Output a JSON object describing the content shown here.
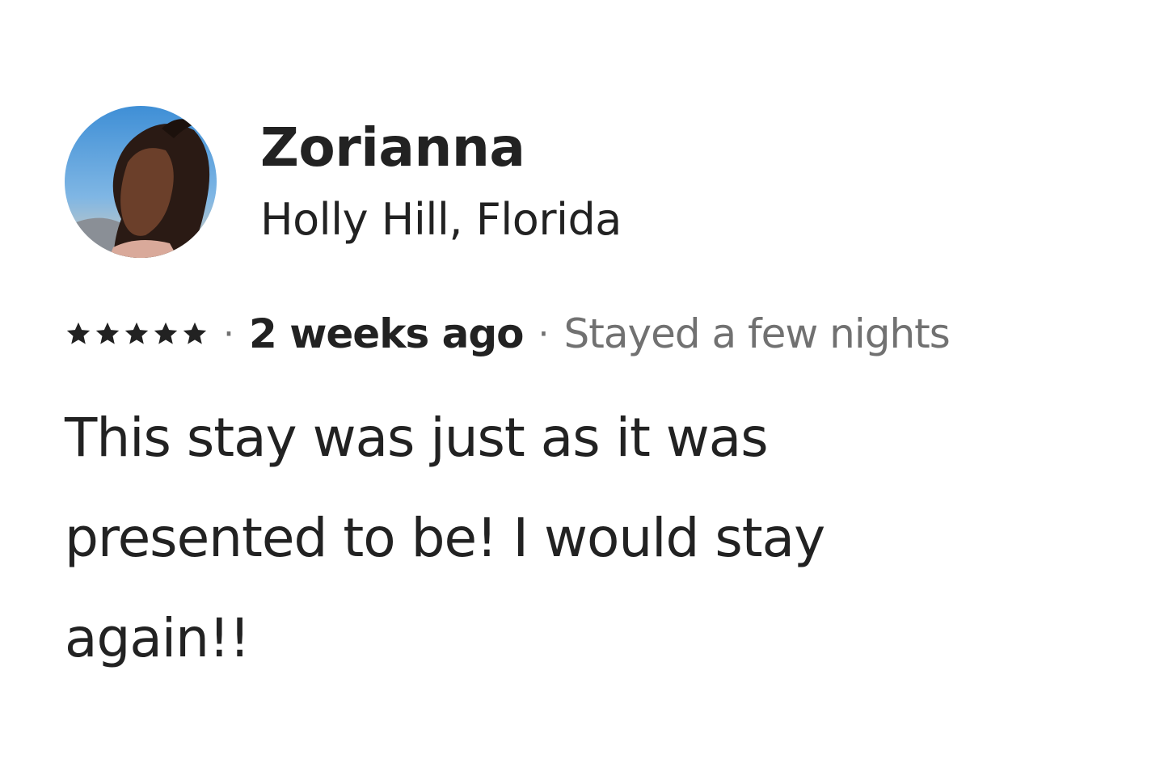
{
  "review": {
    "reviewer_name": "Zorianna",
    "reviewer_location": "Holly Hill, Florida",
    "rating": 5,
    "rating_max": 5,
    "separator": "·",
    "time_ago": "2 weeks ago",
    "stay_length": "Stayed a few nights",
    "text": "This stay was just as it was presented to be! I would stay again!!"
  },
  "icons": {
    "star": "star-icon",
    "avatar": "reviewer-avatar"
  },
  "colors": {
    "primary_text": "#222222",
    "secondary_text": "#717171",
    "star": "#222222"
  }
}
